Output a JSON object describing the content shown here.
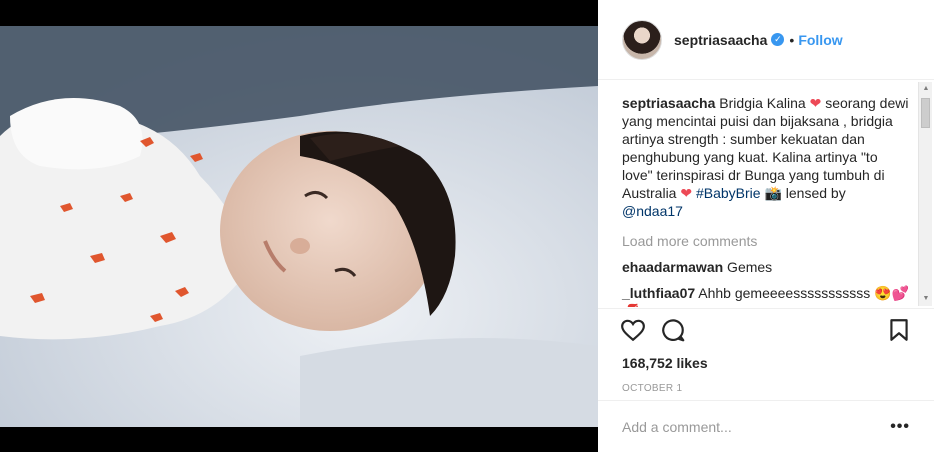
{
  "post": {
    "username": "septriasaacha",
    "follow_label": "Follow",
    "separator": "•",
    "verified_icon": "verified-badge-icon",
    "caption": {
      "username": "septriasaacha",
      "part1": " Bridgia Kalina ",
      "heart1": "❤",
      "part2": " seorang dewi yang mencintai puisi dan bijaksana , bridgia artinya strength : sumber kekuatan dan penghubung yang kuat. Kalina artinya \"to love\" terinspirasi dr Bunga yang tumbuh di Australia ",
      "heart2": "❤",
      "space": " ",
      "hashtag": "#BabyBrie",
      "camera": " 📸 lensed by ",
      "mention": "@ndaa17"
    },
    "load_more": "Load more comments",
    "comments": [
      {
        "username": "ehaadarmawan",
        "text": " Gemes"
      },
      {
        "username": "_luthfiaa07",
        "text": " Ahhb gemeeeesssssssssss 😍💕💋"
      }
    ],
    "likes": "168,752 likes",
    "date": "OCTOBER 1",
    "add_comment_placeholder": "Add a comment...",
    "more_label": "•••"
  },
  "colors": {
    "accent": "#3897f0",
    "heart": "#ed4956",
    "link": "#003569",
    "muted": "#999999"
  }
}
